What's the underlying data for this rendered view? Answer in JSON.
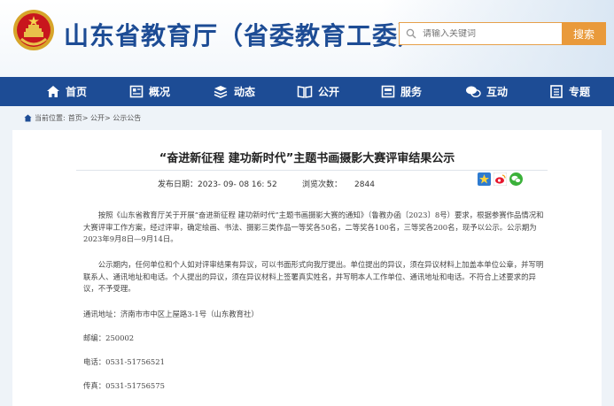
{
  "header": {
    "site_title": "山东省教育厅（省委教育工委）",
    "search_placeholder": "请输入关键词",
    "search_button": "搜索"
  },
  "nav": {
    "items": [
      {
        "label": "首页",
        "icon": "home-icon"
      },
      {
        "label": "概况",
        "icon": "overview-icon"
      },
      {
        "label": "动态",
        "icon": "news-icon"
      },
      {
        "label": "公开",
        "icon": "book-icon"
      },
      {
        "label": "服务",
        "icon": "service-icon"
      },
      {
        "label": "互动",
        "icon": "chat-icon"
      },
      {
        "label": "专题",
        "icon": "topic-icon"
      }
    ]
  },
  "breadcrumb": {
    "prefix": "当前位置:",
    "path": "首页> 公开> 公示公告"
  },
  "article": {
    "title": "“奋进新征程 建功新时代”主题书画摄影大赛评审结果公示",
    "publish_label": "发布日期：",
    "publish_date": "2023- 09- 08 16: 52",
    "views_label": "浏览次数：",
    "views": "2844",
    "paragraph1": "按照《山东省教育厅关于开展“奋进新征程 建功新时代”主题书画摄影大赛的通知》（鲁教办函〔2023〕8号）要求，根据参赛作品情况和大赛评审工作方案，经过评审，确定绘画、书法、摄影三类作品一等奖各50名，二等奖各100名，三等奖各200名，现予以公示。公示期为2023年9月8日—9月14日。",
    "paragraph2": "公示期内，任何单位和个人如对评审结果有异议，可以书面形式向我厅提出。单位提出的异议，须在异议材料上加盖本单位公章，并写明联系人、通讯地址和电话。个人提出的异议，须在异议材料上签署真实姓名，并写明本人工作单位、通讯地址和电话。不符合上述要求的异议，不予受理。",
    "address": "通讯地址：济南市市中区上屋路3-1号（山东教育社）",
    "postcode": "邮编：250002",
    "phone": "电话：0531-51756521",
    "fax": "传真：0531-51756575"
  },
  "colors": {
    "brand_blue": "#1d4c95",
    "search_orange": "#e99a3b"
  }
}
